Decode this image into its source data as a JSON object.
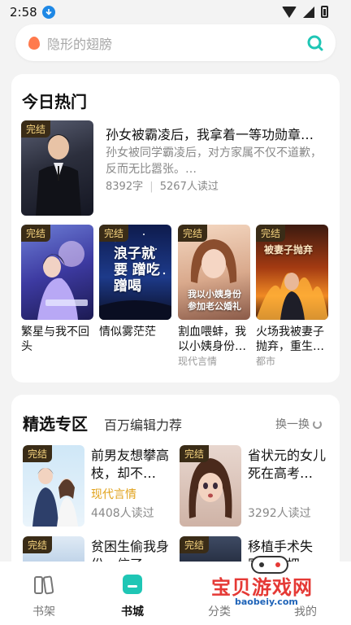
{
  "status": {
    "time": "2:58"
  },
  "search": {
    "placeholder": "隐形的翅膀"
  },
  "hot": {
    "title": "今日热门",
    "featured": {
      "tag": "完结",
      "title": "孙女被霸凌后，我拿着一等功勋章…",
      "desc": "孙女被同学霸凌后，对方家属不仅不道歉，反而无比嚣张。…",
      "words": "8392字",
      "reads": "5267人读过"
    },
    "grid": [
      {
        "tag": "完结",
        "title": "繁星与我不回头",
        "sub": ""
      },
      {
        "tag": "完结",
        "title": "情似雾茫茫",
        "sub": "",
        "cover_text": "浪子就要 蹭吃蹭喝"
      },
      {
        "tag": "完结",
        "title": "割血喂蚌，我以小姨身份…",
        "sub": "现代言情",
        "cover_text": "我以小姨身份参加老公婚礼"
      },
      {
        "tag": "完结",
        "title": "火场我被妻子抛弃，重生…",
        "sub": "都市",
        "cover_text": "被妻子抛弃"
      }
    ]
  },
  "pick": {
    "title": "精选专区",
    "subtitle": "百万编辑力荐",
    "refresh": "换一换",
    "items": [
      {
        "tag": "完结",
        "title": "前男友想攀高枝，却不…",
        "genre": "现代言情",
        "reads": "4408人读过"
      },
      {
        "tag": "完结",
        "title": "省状元的女儿死在高考…",
        "genre": "",
        "reads": "3292人读过"
      },
      {
        "tag": "完结",
        "title": "贫困生偷我身份，信了…",
        "genre": "",
        "reads": ""
      },
      {
        "tag": "完结",
        "title": "移植手术失败，我把…",
        "genre": "",
        "reads": ""
      }
    ]
  },
  "tabs": [
    {
      "label": "书架"
    },
    {
      "label": "书城"
    },
    {
      "label": "分类"
    },
    {
      "label": "我的"
    }
  ],
  "watermark": {
    "text": "宝贝游戏网",
    "url": "baobeiy.com"
  },
  "colors": {
    "accent": "#1fc6b5",
    "tag_bg": "#3a2c17",
    "tag_text": "#f6d47f",
    "genre": "#e1a21b"
  }
}
